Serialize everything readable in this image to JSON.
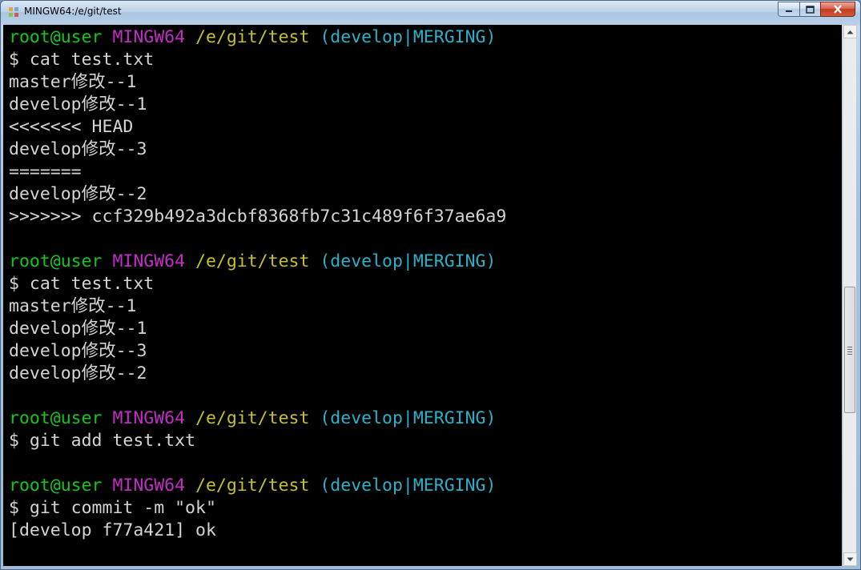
{
  "window": {
    "title": "MINGW64:/e/git/test"
  },
  "colors": {
    "prompt_user": "#13c61b",
    "prompt_system": "#c22dc6",
    "prompt_path": "#c5c02b",
    "prompt_branch": "#2ab1c9",
    "text": "#d4d4d4",
    "background": "#000000"
  },
  "icons": {
    "app": "mingw-icon",
    "minimize": "minimize-icon",
    "maximize": "maximize-icon",
    "close": "close-icon",
    "scroll_up": "arrow-up-icon",
    "scroll_down": "arrow-down-icon"
  },
  "scrollbar": {
    "position_fraction": 0.64
  },
  "terminal": {
    "lines": [
      {
        "type": "prompt",
        "user": "root@user",
        "system": "MINGW64",
        "path": "/e/git/test",
        "branch": "(develop|MERGING)"
      },
      {
        "type": "text",
        "text": "$ cat test.txt"
      },
      {
        "type": "text",
        "text": "master修改--1"
      },
      {
        "type": "text",
        "text": "develop修改--1"
      },
      {
        "type": "text",
        "text": "<<<<<<< HEAD"
      },
      {
        "type": "text",
        "text": "develop修改--3"
      },
      {
        "type": "text",
        "text": "======="
      },
      {
        "type": "text",
        "text": "develop修改--2"
      },
      {
        "type": "text",
        "text": ">>>>>>> ccf329b492a3dcbf8368fb7c31c489f6f37ae6a9"
      },
      {
        "type": "text",
        "text": ""
      },
      {
        "type": "prompt",
        "user": "root@user",
        "system": "MINGW64",
        "path": "/e/git/test",
        "branch": "(develop|MERGING)"
      },
      {
        "type": "text",
        "text": "$ cat test.txt"
      },
      {
        "type": "text",
        "text": "master修改--1"
      },
      {
        "type": "text",
        "text": "develop修改--1"
      },
      {
        "type": "text",
        "text": "develop修改--3"
      },
      {
        "type": "text",
        "text": "develop修改--2"
      },
      {
        "type": "text",
        "text": ""
      },
      {
        "type": "prompt",
        "user": "root@user",
        "system": "MINGW64",
        "path": "/e/git/test",
        "branch": "(develop|MERGING)"
      },
      {
        "type": "text",
        "text": "$ git add test.txt"
      },
      {
        "type": "text",
        "text": ""
      },
      {
        "type": "prompt",
        "user": "root@user",
        "system": "MINGW64",
        "path": "/e/git/test",
        "branch": "(develop|MERGING)"
      },
      {
        "type": "text",
        "text": "$ git commit -m \"ok\""
      },
      {
        "type": "text",
        "text": "[develop f77a421] ok"
      }
    ]
  }
}
